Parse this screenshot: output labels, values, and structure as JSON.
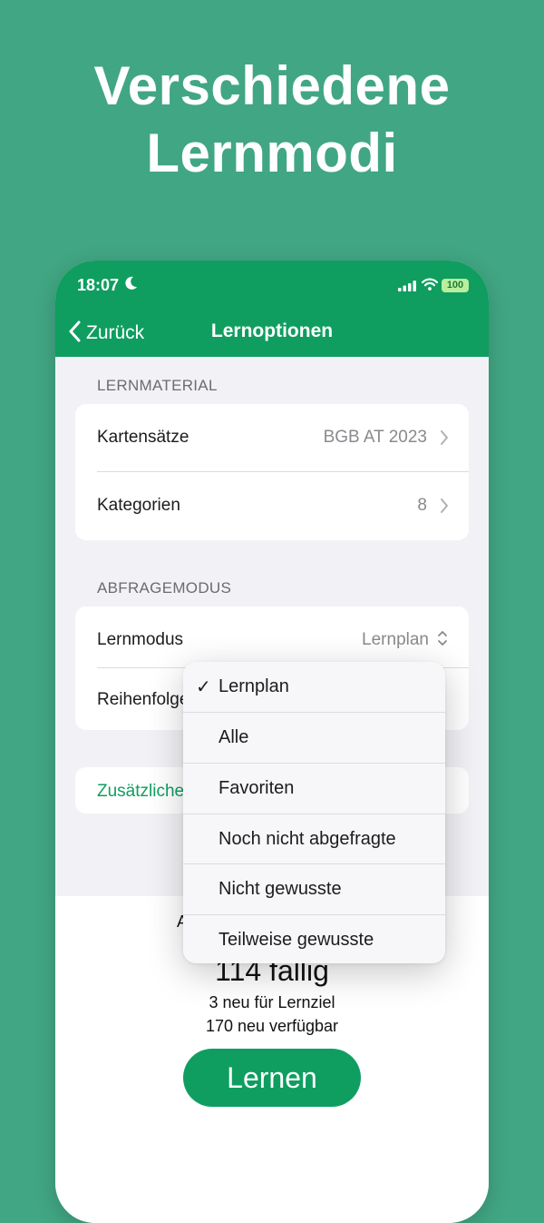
{
  "headline": {
    "line1": "Verschiedene",
    "line2": "Lernmodi"
  },
  "status": {
    "time": "18:07",
    "battery": "100"
  },
  "nav": {
    "back_label": "Zurück",
    "title": "Lernoptionen"
  },
  "sections": {
    "material_header": "LERNMATERIAL",
    "mode_header": "ABFRAGEMODUS"
  },
  "material_rows": [
    {
      "label": "Kartensätze",
      "value": "BGB AT 2023"
    },
    {
      "label": "Kategorien",
      "value": "8"
    }
  ],
  "mode_rows": [
    {
      "label": "Lernmodus",
      "value": "Lernplan"
    },
    {
      "label": "Reihenfolge"
    }
  ],
  "extra_row": {
    "label": "Zusätzliche"
  },
  "bottom": {
    "partial_label": "A",
    "due": "114 fällig",
    "new_goal": "3 neu für Lernziel",
    "new_available": "170 neu verfügbar",
    "learn_button": "Lernen"
  },
  "dropdown": {
    "check_glyph": "✓",
    "selected_index": 0,
    "options": [
      "Lernplan",
      "Alle",
      "Favoriten",
      "Noch nicht abgefragte",
      "Nicht gewusste",
      "Teilweise gewusste"
    ]
  },
  "colors": {
    "background": "#41a683",
    "brand_green": "#0f9e60",
    "link_green": "#0f9e60",
    "battery_fill": "#b8ef9c"
  },
  "icons": [
    "moon-icon",
    "signal-icon",
    "wifi-icon",
    "battery-icon",
    "chevron-left-icon",
    "chevron-right-icon",
    "chevron-updown-icon",
    "checkmark-icon"
  ]
}
